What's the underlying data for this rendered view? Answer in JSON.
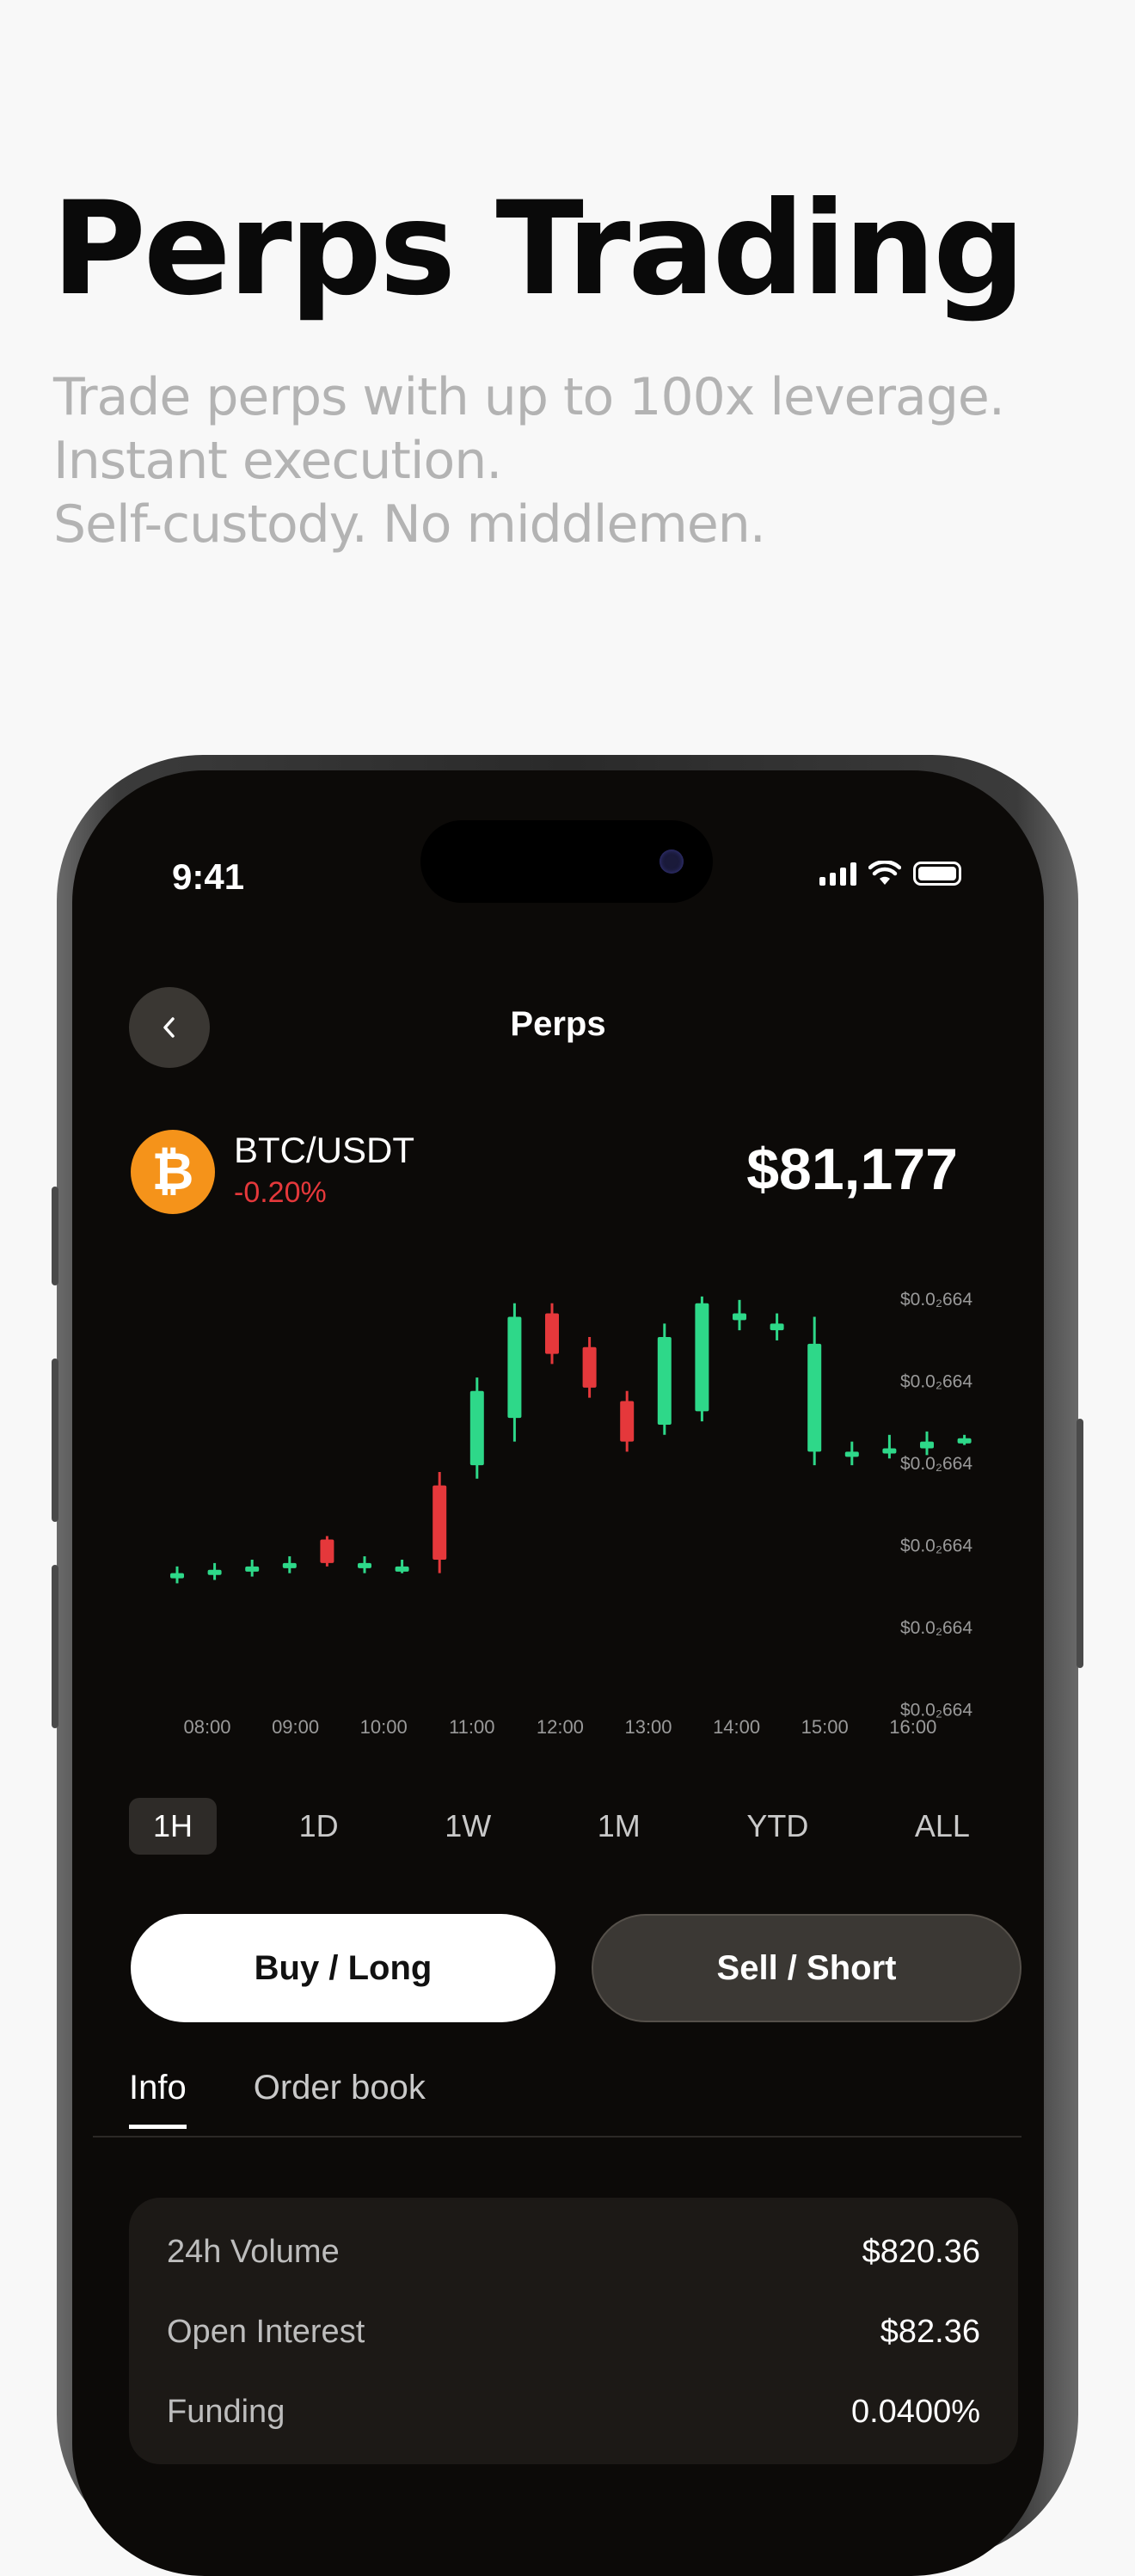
{
  "headline": "Perps Trading",
  "subline": [
    "Trade perps with up to 100x leverage.",
    "Instant execution.",
    "Self-custody. No middlemen."
  ],
  "status": {
    "time": "9:41"
  },
  "nav": {
    "title": "Perps",
    "back_icon": "chevron-left-icon"
  },
  "asset": {
    "icon": "bitcoin-icon",
    "icon_glyph": "₿",
    "pair": "BTC/USDT",
    "change": "-0.20%",
    "price": "$81,177",
    "up_color": "#2ed889",
    "down_color": "#e5383b"
  },
  "chart_data": {
    "type": "candlestick",
    "x_ticks": [
      "08:00",
      "09:00",
      "10:00",
      "11:00",
      "12:00",
      "13:00",
      "14:00",
      "15:00",
      "16:00"
    ],
    "y_ticks": [
      "$0.0₂664",
      "$0.0₂664",
      "$0.0₂664",
      "$0.0₂664",
      "$0.0₂664",
      "$0.0₂664"
    ],
    "candles": [
      {
        "o": 21,
        "c": 22,
        "h": 24,
        "l": 19,
        "dir": "up"
      },
      {
        "o": 22,
        "c": 23,
        "h": 25,
        "l": 20,
        "dir": "up"
      },
      {
        "o": 23,
        "c": 24,
        "h": 26,
        "l": 21,
        "dir": "up"
      },
      {
        "o": 24,
        "c": 25,
        "h": 27,
        "l": 22,
        "dir": "up"
      },
      {
        "o": 32,
        "c": 25,
        "h": 33,
        "l": 24,
        "dir": "down"
      },
      {
        "o": 25,
        "c": 24,
        "h": 27,
        "l": 22,
        "dir": "up"
      },
      {
        "o": 24,
        "c": 23,
        "h": 26,
        "l": 22,
        "dir": "up"
      },
      {
        "o": 48,
        "c": 26,
        "h": 52,
        "l": 22,
        "dir": "down"
      },
      {
        "o": 54,
        "c": 76,
        "h": 80,
        "l": 50,
        "dir": "up"
      },
      {
        "o": 68,
        "c": 98,
        "h": 102,
        "l": 61,
        "dir": "up"
      },
      {
        "o": 99,
        "c": 87,
        "h": 102,
        "l": 84,
        "dir": "down"
      },
      {
        "o": 89,
        "c": 77,
        "h": 92,
        "l": 74,
        "dir": "down"
      },
      {
        "o": 73,
        "c": 61,
        "h": 76,
        "l": 58,
        "dir": "down"
      },
      {
        "o": 66,
        "c": 92,
        "h": 96,
        "l": 63,
        "dir": "up"
      },
      {
        "o": 70,
        "c": 102,
        "h": 104,
        "l": 67,
        "dir": "up"
      },
      {
        "o": 97,
        "c": 99,
        "h": 103,
        "l": 94,
        "dir": "up"
      },
      {
        "o": 94,
        "c": 96,
        "h": 99,
        "l": 91,
        "dir": "up"
      },
      {
        "o": 90,
        "c": 58,
        "h": 98,
        "l": 54,
        "dir": "up"
      },
      {
        "o": 57,
        "c": 58,
        "h": 61,
        "l": 54,
        "dir": "up"
      },
      {
        "o": 58,
        "c": 59,
        "h": 63,
        "l": 56,
        "dir": "up"
      },
      {
        "o": 59,
        "c": 61,
        "h": 64,
        "l": 57,
        "dir": "up"
      },
      {
        "o": 61,
        "c": 62,
        "h": 63,
        "l": 60,
        "dir": "up"
      }
    ],
    "ylim": [
      0,
      105
    ],
    "grid": false
  },
  "ranges": [
    "1H",
    "1D",
    "1W",
    "1M",
    "YTD",
    "ALL"
  ],
  "actions": {
    "buy": "Buy / Long",
    "sell": "Sell / Short"
  },
  "tabs": [
    "Info",
    "Order book"
  ],
  "info": [
    {
      "label": "24h Volume",
      "value": "$820.36"
    },
    {
      "label": "Open Interest",
      "value": "$82.36"
    },
    {
      "label": "Funding",
      "value": "0.0400%"
    }
  ]
}
